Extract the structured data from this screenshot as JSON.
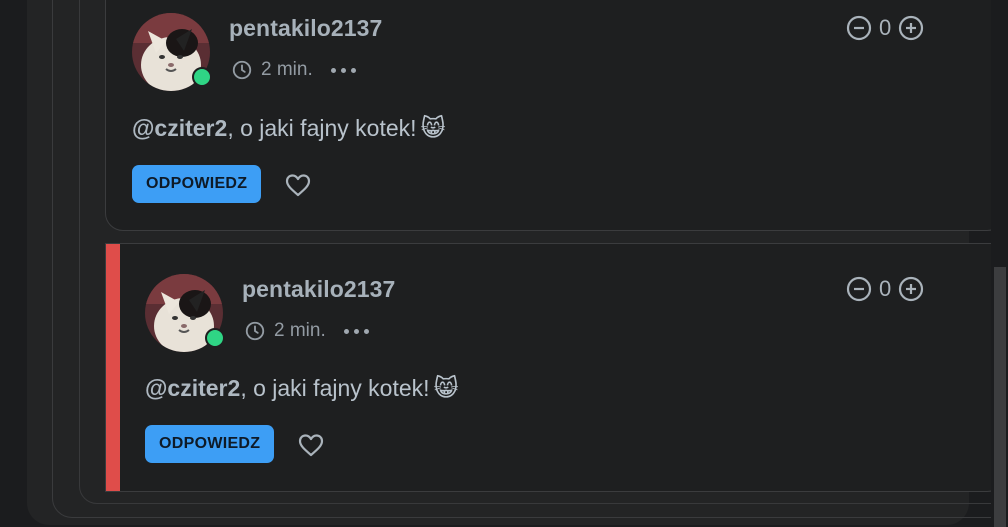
{
  "comments": [
    {
      "username": "pentakilo2137",
      "time": "2 min.",
      "score": "0",
      "mention": "@cziter2",
      "text": ", o jaki fajny kotek!",
      "emoji": "😸",
      "reply_label": "ODPOWIEDZ",
      "online": true,
      "highlighted": false
    },
    {
      "username": "pentakilo2137",
      "time": "2 min.",
      "score": "0",
      "mention": "@cziter2",
      "text": ", o jaki fajny kotek!",
      "emoji": "😸",
      "reply_label": "ODPOWIEDZ",
      "online": true,
      "highlighted": true
    }
  ],
  "colors": {
    "accent": "#3d9ef5",
    "online": "#2fd585",
    "highlight": "#df4d4a",
    "background": "#1b1c1e"
  },
  "icons": [
    "clock-icon",
    "more-icon",
    "downvote-icon",
    "upvote-icon",
    "heart-icon"
  ]
}
